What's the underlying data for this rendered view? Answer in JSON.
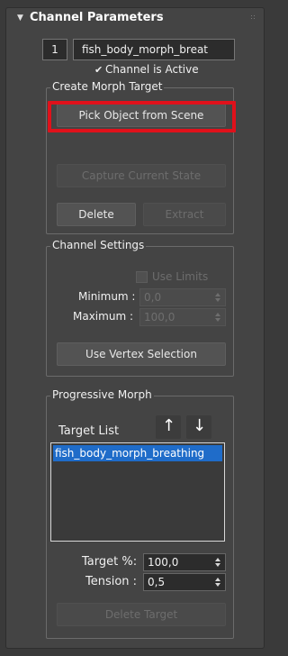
{
  "rollout": {
    "arrow": "▼",
    "title": "Channel Parameters"
  },
  "channel": {
    "index": "1",
    "name": "fish_body_morph_breat",
    "active_label": "Channel is Active",
    "active_checked": true
  },
  "create_morph_target": {
    "title": "Create Morph Target",
    "pick_object": "Pick Object from Scene",
    "capture_state": "Capture Current State",
    "delete": "Delete",
    "extract": "Extract"
  },
  "channel_settings": {
    "title": "Channel Settings",
    "use_limits": "Use Limits",
    "minimum_label": "Minimum :",
    "minimum_value": "0,0",
    "maximum_label": "Maximum :",
    "maximum_value": "100,0",
    "use_vertex_selection": "Use Vertex Selection"
  },
  "progressive_morph": {
    "title": "Progressive Morph",
    "target_list_label": "Target List",
    "up_arrow": "↑",
    "down_arrow": "↓",
    "targets": [
      "fish_body_morph_breathing"
    ],
    "target_pct_label": "Target %:",
    "target_pct_value": "100,0",
    "tension_label": "Tension :",
    "tension_value": "0,5",
    "delete_target": "Delete Target"
  },
  "colors": {
    "highlight": "#e0111b",
    "selection": "#1f6cc9",
    "panel_bg": "#444444"
  }
}
